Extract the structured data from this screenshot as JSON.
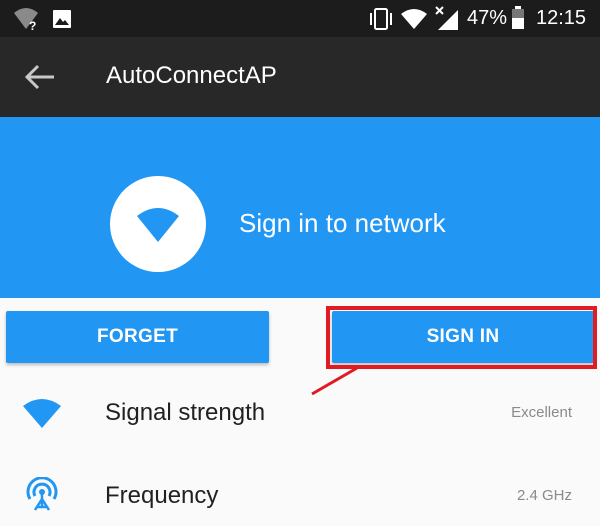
{
  "status_bar": {
    "battery_percent": "47%",
    "time": "12:15",
    "icons": [
      "wifi-unknown-icon",
      "image-icon",
      "vibrate-icon",
      "wifi-icon",
      "signal-no-data-icon",
      "battery-icon"
    ]
  },
  "app_bar": {
    "back_icon": "arrow-back-icon",
    "title": "AutoConnectAP"
  },
  "header": {
    "icon": "wifi-icon",
    "title": "Sign in to network"
  },
  "buttons": {
    "forget_label": "FORGET",
    "signin_label": "SIGN IN"
  },
  "details": [
    {
      "icon": "wifi-signal-icon",
      "label": "Signal strength",
      "value": "Excellent"
    },
    {
      "icon": "antenna-icon",
      "label": "Frequency",
      "value": "2.4 GHz"
    }
  ],
  "colors": {
    "primary": "#2196f3",
    "app_bar": "#282828",
    "status_bar": "#1c1c1c",
    "annotation": "#e01b24"
  }
}
